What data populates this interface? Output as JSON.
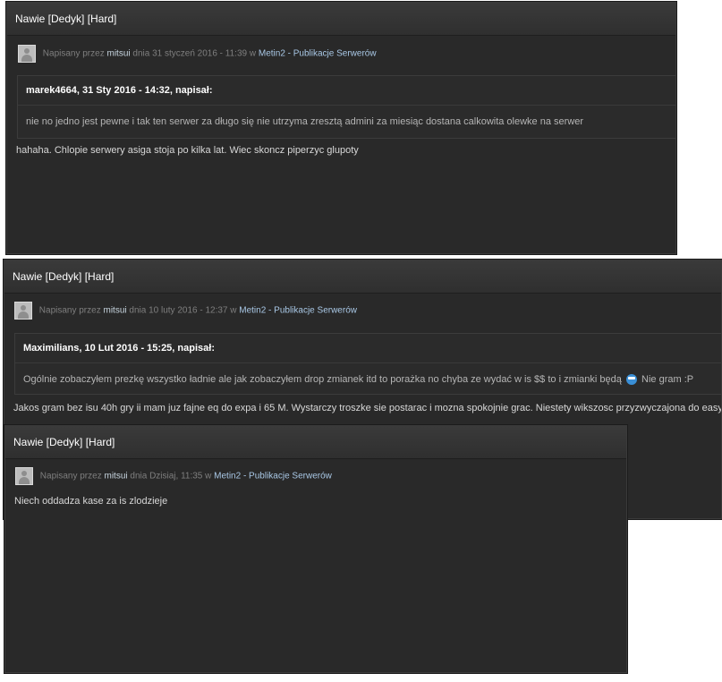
{
  "posts": [
    {
      "title": "Nawie [Dedyk] [Hard]",
      "meta_prefix": "Napisany przez",
      "author": "mitsui",
      "date": "dnia 31 styczeń 2016 - 11:39 w",
      "category": "Metin2 - Publikacje Serwerów",
      "quote_header": "marek4664, 31 Sty 2016 - 14:32, napisał:",
      "quote_text": "nie no jedno jest pewne i tak ten  serwer za długo się nie utrzyma zresztą admini za miesiąc dostana calkowita olewke na serwer",
      "body": "hahaha. Chlopie serwery asiga stoja po kilka lat. Wiec skoncz piperzyc glupoty"
    },
    {
      "title": "Nawie [Dedyk] [Hard]",
      "meta_prefix": "Napisany przez",
      "author": "mitsui",
      "date": "dnia 10 luty 2016 - 12:37 w",
      "category": "Metin2 - Publikacje Serwerów",
      "quote_header": "Maximilians, 10 Lut 2016 - 15:25, napisał:",
      "quote_text_before": "Ogólnie zobaczyłem prezkę wszystko ładnie ale jak zobaczyłem drop zmianek itd to porażka no chyba ze wydać w is $$ to i zmianki będą",
      "quote_text_after": "Nie gram :P",
      "body": "Jakos gram bez isu 40h gry ii mam juz fajne eq do expa i 65 M. Wystarczy troszke sie postarac i mozna spokojnie grac. Niestety wikszosc przyzwyczajona do easy..."
    },
    {
      "title": "Nawie [Dedyk] [Hard]",
      "meta_prefix": "Napisany przez",
      "author": "mitsui",
      "date": "dnia Dzisiaj, 11:35 w",
      "category": "Metin2 - Publikacje Serwerów",
      "body": "Niech oddadza kase za is zlodzieje"
    }
  ],
  "icons": {
    "avatar": "default-avatar-icon",
    "smiley": "grin-emoticon-icon"
  },
  "colors": {
    "panel_bg": "#292929",
    "header_bg": "#353535",
    "link": "#a9c8e6",
    "text": "#d8d8d8"
  }
}
